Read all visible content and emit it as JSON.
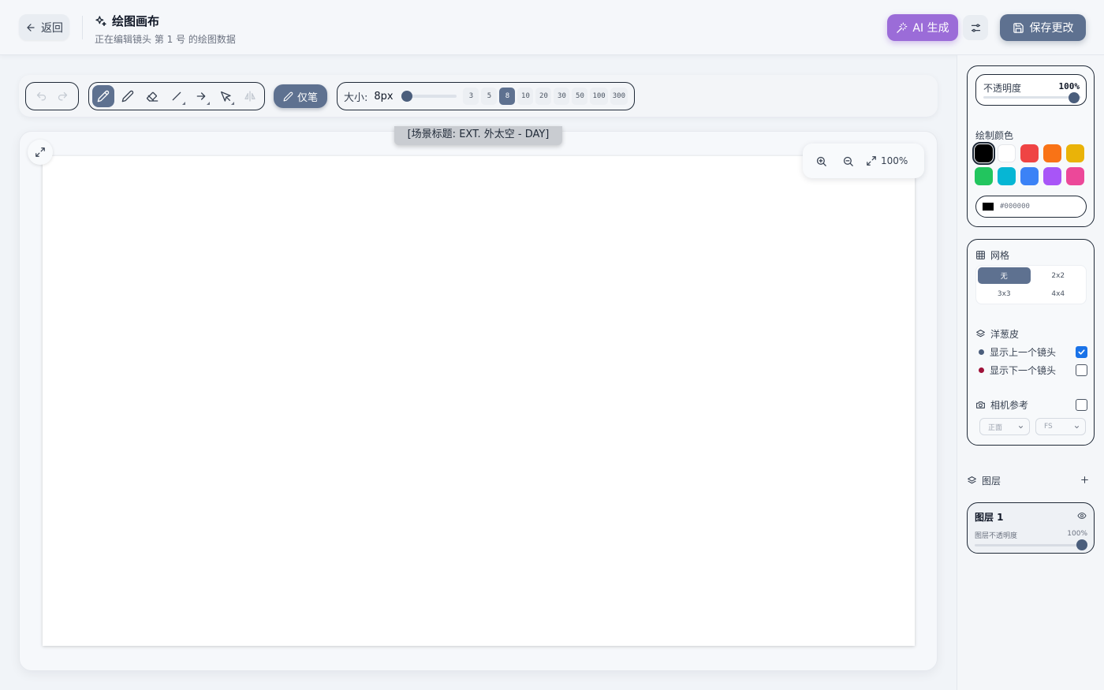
{
  "header": {
    "back_label": "返回",
    "title": "绘图画布",
    "subtitle": "正在编辑镜头 第 1 号 的绘图数据",
    "ai_label": "AI 生成",
    "save_label": "保存更改",
    "ai_color": "#9b6cd8",
    "save_color": "#5e7190"
  },
  "toolbar": {
    "tools": [
      "undo-icon",
      "redo-icon",
      "pen-icon",
      "pencil-icon",
      "eraser-icon",
      "line-icon",
      "arrow-icon",
      "select-icon",
      "mirror-icon"
    ],
    "active_tool": "pen",
    "pen_only_label": "仅笔",
    "size_label": "大小:",
    "size_value": "8px",
    "size_presets": [
      "3",
      "5",
      "8",
      "10",
      "20",
      "30",
      "50",
      "100",
      "300"
    ],
    "active_preset": "8"
  },
  "canvas": {
    "scene_title": "[场景标题: EXT. 外太空 - DAY]",
    "zoom": "100%"
  },
  "sidebar": {
    "opacity_label": "不透明度",
    "opacity_value": "100%",
    "color_label": "绘制颜色",
    "swatches": [
      "#000000",
      "#ffffff",
      "#ef4444",
      "#f97316",
      "#eab308",
      "#22c55e",
      "#06b6d4",
      "#3b82f6",
      "#a855f7",
      "#ec4899"
    ],
    "selected_color": "#000000",
    "hex_value": "#000000",
    "grid_label": "网格",
    "grid_options": [
      "无",
      "2x2",
      "3x3",
      "4x4"
    ],
    "grid_active": "无",
    "onion_label": "洋葱皮",
    "show_prev_label": "显示上一个镜头",
    "show_next_label": "显示下一个镜头",
    "show_prev_checked": true,
    "show_next_checked": false,
    "prev_dot_color": "#4b5e7c",
    "next_dot_color": "#9f1239",
    "camera_label": "相机参考",
    "camera_checked": false,
    "camera_view": "正面",
    "camera_shot": "FS",
    "layers_label": "图层",
    "layer": {
      "name": "图层 1",
      "opacity_label": "图层不透明度",
      "opacity_value": "100%"
    }
  }
}
